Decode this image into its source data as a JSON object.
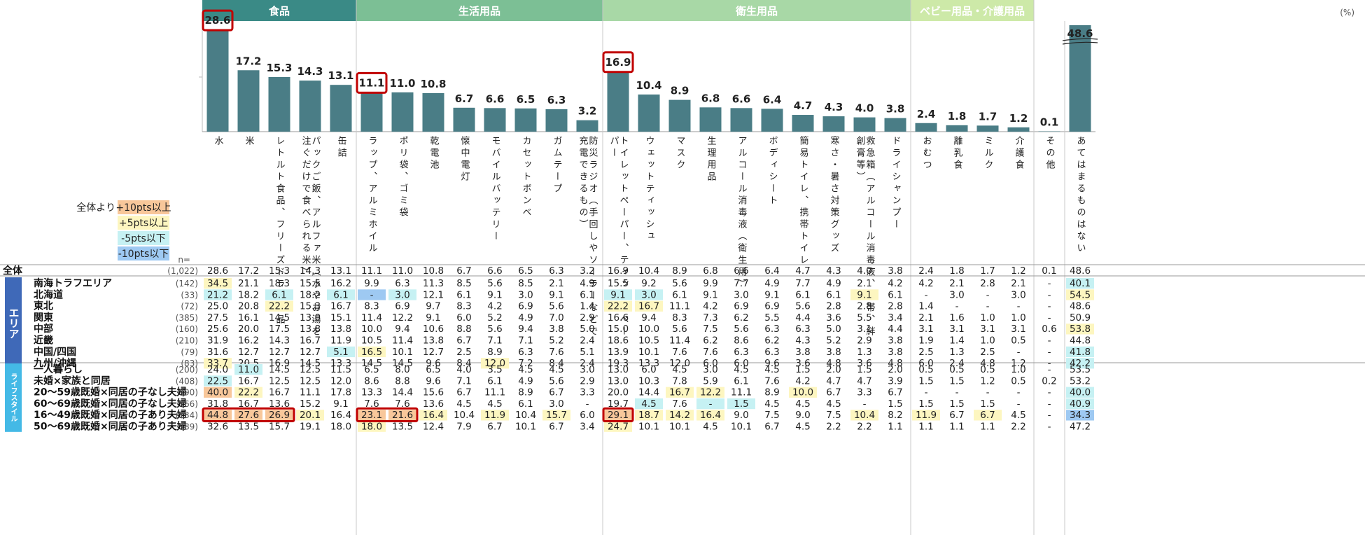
{
  "chart_data": {
    "type": "bar",
    "unit": "(%)",
    "n_label": "n=",
    "categories": [
      {
        "name": "食品",
        "color": "#3a8a86",
        "start": 0,
        "end": 5
      },
      {
        "name": "生活用品",
        "color": "#7cbf95",
        "start": 5,
        "end": 13
      },
      {
        "name": "衛生用品",
        "color": "#a8d8a6",
        "start": 13,
        "end": 23
      },
      {
        "name": "ベビー用品・介護用品",
        "color": "#cde9a8",
        "start": 23,
        "end": 27
      }
    ],
    "items": [
      "水",
      "米",
      "レトルト食品、フリーズドライ食品",
      "パックご飯、アルファ米（水やお湯を注ぐだけで食べられる米）",
      "缶詰",
      "ラップ、アルミホイル",
      "ポリ袋、ゴミ袋",
      "乾電池",
      "懐中電灯",
      "モバイルバッテリー",
      "カセットボンベ",
      "ガムテープ",
      "防災ラジオ（手回しやソーラーなどで充電できるもの）",
      "トイレットペーパー、ティッシュペーパー",
      "ウェットティッシュ",
      "マスク",
      "生理用品",
      "アルコール消毒液（衛生用）",
      "ボディシート",
      "簡易トイレ、携帯トイレ",
      "寒さ・暑さ対策グッズ",
      "救急箱（アルコール消毒液、包帯、絆創膏等）",
      "ドライシャンプー",
      "おむつ",
      "離乳食",
      "ミルク",
      "介護食",
      "その他",
      "あてはまるものはない"
    ],
    "values": [
      28.6,
      17.2,
      15.3,
      14.3,
      13.1,
      11.1,
      11.0,
      10.8,
      6.7,
      6.6,
      6.5,
      6.3,
      3.2,
      16.9,
      10.4,
      8.9,
      6.8,
      6.6,
      6.4,
      4.7,
      4.3,
      4.0,
      3.8,
      2.4,
      1.8,
      1.7,
      1.2,
      0.1,
      48.6
    ],
    "highlighted_bars": [
      0,
      5,
      13
    ],
    "legend": {
      "title": "全体より",
      "items": [
        {
          "label": "+10pts以上",
          "color": "#f8c79a"
        },
        {
          "label": "+5pts以上",
          "color": "#fdf6c0"
        },
        {
          "label": "-5pts以下",
          "color": "#c6f1f3"
        },
        {
          "label": "-10pts以下",
          "color": "#9ec9f2"
        }
      ]
    },
    "total_row": {
      "label": "全体",
      "n": "(1,022)",
      "values": [
        "28.6",
        "17.2",
        "15.3",
        "14.3",
        "13.1",
        "11.1",
        "11.0",
        "10.8",
        "6.7",
        "6.6",
        "6.5",
        "6.3",
        "3.2",
        "16.9",
        "10.4",
        "8.9",
        "6.8",
        "6.6",
        "6.4",
        "4.7",
        "4.3",
        "4.0",
        "3.8",
        "2.4",
        "1.8",
        "1.7",
        "1.2",
        "0.1",
        "48.6"
      ]
    },
    "groups": [
      {
        "name": "エリア",
        "color": "#3f69b8",
        "rows": [
          {
            "label": "南海トラフエリア",
            "n": "(142)",
            "values": [
              "34.5",
              "21.1",
              "18.3",
              "15.5",
              "16.2",
              "9.9",
              "6.3",
              "11.3",
              "8.5",
              "5.6",
              "8.5",
              "2.1",
              "4.9",
              "15.5",
              "9.2",
              "5.6",
              "9.9",
              "7.7",
              "4.9",
              "7.7",
              "4.9",
              "2.1",
              "4.2",
              "4.2",
              "2.1",
              "2.8",
              "2.1",
              "-",
              "40.1"
            ],
            "shade": {
              "0": "y",
              "28": "c"
            }
          },
          {
            "label": "北海道",
            "n": "(33)",
            "values": [
              "21.2",
              "18.2",
              "6.1",
              "18.2",
              "6.1",
              "-",
              "3.0",
              "12.1",
              "6.1",
              "9.1",
              "3.0",
              "9.1",
              "6.1",
              "9.1",
              "3.0",
              "6.1",
              "9.1",
              "3.0",
              "9.1",
              "6.1",
              "6.1",
              "9.1",
              "6.1",
              "-",
              "3.0",
              "-",
              "3.0",
              "-",
              "54.5"
            ],
            "shade": {
              "0": "c",
              "2": "c",
              "4": "c",
              "5": "b",
              "6": "c",
              "13": "c",
              "14": "c",
              "21": "y",
              "28": "y"
            }
          },
          {
            "label": "東北",
            "n": "(72)",
            "values": [
              "25.0",
              "20.8",
              "22.2",
              "15.3",
              "16.7",
              "8.3",
              "6.9",
              "9.7",
              "8.3",
              "4.2",
              "6.9",
              "5.6",
              "1.4",
              "22.2",
              "16.7",
              "11.1",
              "4.2",
              "6.9",
              "6.9",
              "5.6",
              "2.8",
              "2.8",
              "2.8",
              "1.4",
              "-",
              "-",
              "-",
              "-",
              "48.6"
            ],
            "shade": {
              "2": "y",
              "13": "y",
              "14": "y"
            }
          },
          {
            "label": "関東",
            "n": "(385)",
            "values": [
              "27.5",
              "16.1",
              "14.5",
              "13.0",
              "15.1",
              "11.4",
              "12.2",
              "9.1",
              "6.0",
              "5.2",
              "4.9",
              "7.0",
              "2.9",
              "16.6",
              "9.4",
              "8.3",
              "7.3",
              "6.2",
              "5.5",
              "4.4",
              "3.6",
              "5.5",
              "3.4",
              "2.1",
              "1.6",
              "1.0",
              "1.0",
              "-",
              "50.9"
            ],
            "shade": {}
          },
          {
            "label": "中部",
            "n": "(160)",
            "values": [
              "25.6",
              "20.0",
              "17.5",
              "13.8",
              "13.8",
              "10.0",
              "9.4",
              "10.6",
              "8.8",
              "5.6",
              "9.4",
              "3.8",
              "5.0",
              "15.0",
              "10.0",
              "5.6",
              "7.5",
              "5.6",
              "6.3",
              "6.3",
              "5.0",
              "3.1",
              "4.4",
              "3.1",
              "3.1",
              "3.1",
              "3.1",
              "0.6",
              "53.8"
            ],
            "shade": {
              "28": "y"
            }
          },
          {
            "label": "近畿",
            "n": "(210)",
            "values": [
              "31.9",
              "16.2",
              "14.3",
              "16.7",
              "11.9",
              "10.5",
              "11.4",
              "13.8",
              "6.7",
              "7.1",
              "7.1",
              "5.2",
              "2.4",
              "18.6",
              "10.5",
              "11.4",
              "6.2",
              "8.6",
              "6.2",
              "4.3",
              "5.2",
              "2.9",
              "3.8",
              "1.9",
              "1.4",
              "1.0",
              "0.5",
              "-",
              "44.8"
            ],
            "shade": {}
          },
          {
            "label": "中国/四国",
            "n": "(79)",
            "values": [
              "31.6",
              "12.7",
              "12.7",
              "12.7",
              "5.1",
              "16.5",
              "10.1",
              "12.7",
              "2.5",
              "8.9",
              "6.3",
              "7.6",
              "5.1",
              "13.9",
              "10.1",
              "7.6",
              "7.6",
              "6.3",
              "6.3",
              "3.8",
              "3.8",
              "1.3",
              "3.8",
              "2.5",
              "1.3",
              "2.5",
              "-",
              "-",
              "41.8"
            ],
            "shade": {
              "4": "c",
              "5": "y",
              "28": "c"
            }
          },
          {
            "label": "九州/沖縄",
            "n": "(83)",
            "values": [
              "33.7",
              "20.5",
              "16.9",
              "14.5",
              "13.3",
              "14.5",
              "14.5",
              "9.6",
              "8.4",
              "12.0",
              "7.2",
              "8.4",
              "2.4",
              "19.3",
              "13.3",
              "12.0",
              "6.0",
              "6.0",
              "9.6",
              "3.6",
              "4.8",
              "3.6",
              "4.8",
              "6.0",
              "2.4",
              "4.8",
              "1.2",
              "-",
              "42.2"
            ],
            "shade": {
              "0": "y",
              "9": "y",
              "28": "c"
            }
          }
        ]
      },
      {
        "name": "ライフスタイル",
        "color": "#44b9e6",
        "rows": [
          {
            "label": "一人暮らし",
            "n": "(200)",
            "values": [
              "24.0",
              "11.0",
              "14.5",
              "12.5",
              "11.5",
              "6.5",
              "8.0",
              "6.5",
              "4.0",
              "3.5",
              "4.5",
              "4.5",
              "3.0",
              "13.0",
              "6.0",
              "4.5",
              "3.0",
              "4.5",
              "4.5",
              "1.5",
              "2.0",
              "1.5",
              "2.0",
              "0.5",
              "0.5",
              "0.5",
              "1.0",
              "-",
              "53.5"
            ],
            "shade": {
              "1": "c"
            }
          },
          {
            "label": "未婚×家族と同居",
            "n": "(408)",
            "values": [
              "22.5",
              "16.7",
              "12.5",
              "12.5",
              "12.0",
              "8.6",
              "8.8",
              "9.6",
              "7.1",
              "6.1",
              "4.9",
              "5.6",
              "2.9",
              "13.0",
              "10.3",
              "7.8",
              "5.9",
              "6.1",
              "7.6",
              "4.2",
              "4.7",
              "4.7",
              "3.9",
              "1.5",
              "1.5",
              "1.2",
              "0.5",
              "0.2",
              "53.2"
            ],
            "shade": {
              "0": "c"
            }
          },
          {
            "label": "20～59歳既婚×同居の子なし夫婦",
            "n": "(90)",
            "values": [
              "40.0",
              "22.2",
              "16.7",
              "11.1",
              "17.8",
              "13.3",
              "14.4",
              "15.6",
              "6.7",
              "11.1",
              "8.9",
              "6.7",
              "3.3",
              "20.0",
              "14.4",
              "16.7",
              "12.2",
              "11.1",
              "8.9",
              "10.0",
              "6.7",
              "3.3",
              "6.7",
              "-",
              "-",
              "-",
              "-",
              "-",
              "40.0"
            ],
            "shade": {
              "0": "o",
              "1": "y",
              "15": "y",
              "16": "y",
              "19": "y",
              "28": "c"
            }
          },
          {
            "label": "60～69歳既婚×同居の子なし夫婦",
            "n": "(66)",
            "values": [
              "31.8",
              "16.7",
              "13.6",
              "15.2",
              "9.1",
              "7.6",
              "7.6",
              "13.6",
              "4.5",
              "4.5",
              "6.1",
              "3.0",
              "-",
              "19.7",
              "4.5",
              "7.6",
              "-",
              "1.5",
              "4.5",
              "4.5",
              "4.5",
              "-",
              "1.5",
              "1.5",
              "1.5",
              "1.5",
              "-",
              "-",
              "40.9"
            ],
            "shade": {
              "14": "c",
              "16": "c",
              "17": "c",
              "28": "c"
            }
          },
          {
            "label": "16～49歳既婚×同居の子あり夫婦",
            "n": "(134)",
            "values": [
              "44.8",
              "27.6",
              "26.9",
              "20.1",
              "16.4",
              "23.1",
              "21.6",
              "16.4",
              "10.4",
              "11.9",
              "10.4",
              "15.7",
              "6.0",
              "29.1",
              "18.7",
              "14.2",
              "16.4",
              "9.0",
              "7.5",
              "9.0",
              "7.5",
              "10.4",
              "8.2",
              "11.9",
              "6.7",
              "6.7",
              "4.5",
              "-",
              "34.3"
            ],
            "shade": {
              "0": "o",
              "1": "o",
              "2": "o",
              "3": "y",
              "5": "o",
              "6": "o",
              "7": "y",
              "9": "y",
              "11": "y",
              "13": "o",
              "14": "y",
              "15": "y",
              "16": "y",
              "21": "y",
              "23": "y",
              "25": "y",
              "28": "b"
            }
          },
          {
            "label": "50～69歳既婚×同居の子あり夫婦",
            "n": "(89)",
            "values": [
              "32.6",
              "13.5",
              "15.7",
              "19.1",
              "18.0",
              "18.0",
              "13.5",
              "12.4",
              "7.9",
              "6.7",
              "10.1",
              "6.7",
              "3.4",
              "24.7",
              "10.1",
              "10.1",
              "4.5",
              "10.1",
              "6.7",
              "4.5",
              "2.2",
              "2.2",
              "1.1",
              "1.1",
              "1.1",
              "1.1",
              "2.2",
              "-",
              "47.2"
            ],
            "shade": {
              "5": "y",
              "13": "y"
            }
          }
        ]
      }
    ],
    "highlight_cells": [
      {
        "row": 12,
        "from": 0,
        "to": 2
      },
      {
        "row": 12,
        "from": 5,
        "to": 6
      },
      {
        "row": 12,
        "from": 13,
        "to": 13
      }
    ]
  }
}
